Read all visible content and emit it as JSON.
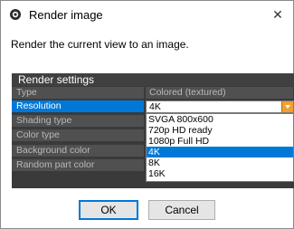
{
  "window": {
    "title": "Render image",
    "close_glyph": "✕",
    "icon": "render-image-icon"
  },
  "description": "Render the current view to an image.",
  "panel": {
    "title": "Render settings",
    "rows": [
      {
        "label": "Type",
        "value": "Colored (textured)"
      },
      {
        "label": "Resolution",
        "value": "4K"
      },
      {
        "label": "Shading type",
        "value": ""
      },
      {
        "label": "Color type",
        "value": ""
      },
      {
        "label": "Background color",
        "value": ""
      },
      {
        "label": "Random part color",
        "value": ""
      }
    ]
  },
  "resolution_dropdown": {
    "selected": "4K",
    "options": [
      "SVGA 800x600",
      "720p HD ready",
      "1080p Full HD",
      "4K",
      "8K",
      "16K"
    ],
    "selected_index": 3,
    "accent": "#0078d7",
    "button_color": "#f0a030"
  },
  "buttons": {
    "ok": "OK",
    "cancel": "Cancel"
  }
}
